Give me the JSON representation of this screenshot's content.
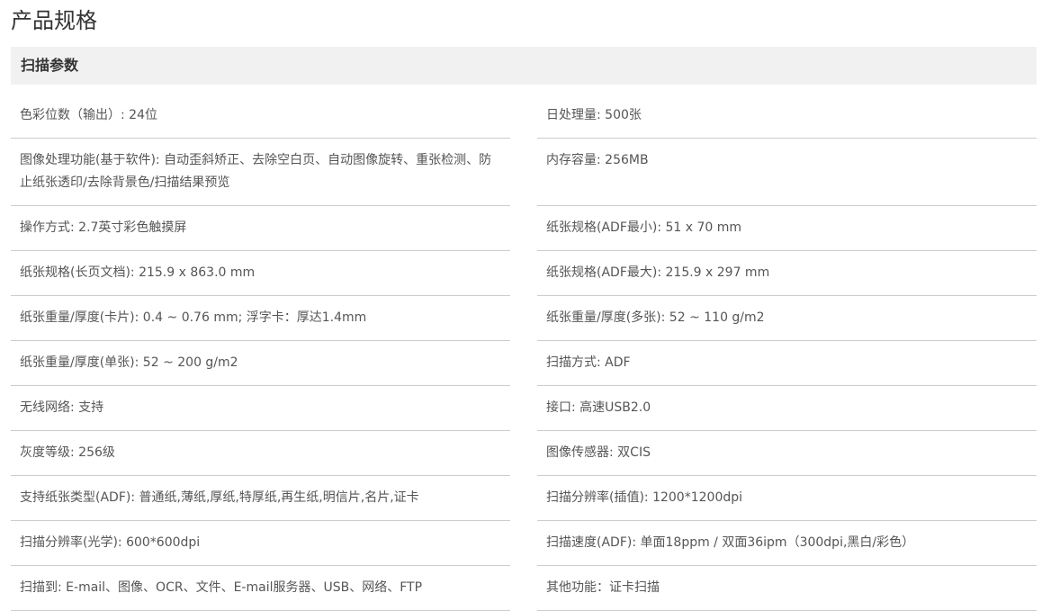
{
  "page_title": "产品规格",
  "section_title": "扫描参数",
  "specs": {
    "left": [
      "色彩位数（输出）: 24位",
      "图像处理功能(基于软件): 自动歪斜矫正、去除空白页、自动图像旋转、重张检测、防止纸张透印/去除背景色/扫描结果预览",
      "操作方式: 2.7英寸彩色触摸屏",
      "纸张规格(长页文档): 215.9 x 863.0 mm",
      "纸张重量/厚度(卡片): 0.4 ~ 0.76 mm; 浮字卡：厚达1.4mm",
      "纸张重量/厚度(单张): 52 ~ 200 g/m2",
      "无线网络: 支持",
      "灰度等级: 256级",
      "支持纸张类型(ADF): 普通纸,薄纸,厚纸,特厚纸,再生纸,明信片,名片,证卡",
      "扫描分辨率(光学): 600*600dpi",
      "扫描到: E-mail、图像、OCR、文件、E-mail服务器、USB、网络、FTP"
    ],
    "right": [
      "日处理量: 500张",
      "内存容量: 256MB",
      "纸张规格(ADF最小): 51 x 70 mm",
      "纸张规格(ADF最大): 215.9 x 297 mm",
      "纸张重量/厚度(多张): 52 ~ 110 g/m2",
      "扫描方式: ADF",
      "接口: 高速USB2.0",
      "图像传感器: 双CIS",
      "扫描分辨率(插值): 1200*1200dpi",
      "扫描速度(ADF): 单面18ppm / 双面36ipm（300dpi,黑白/彩色）",
      "其他功能：证卡扫描"
    ]
  }
}
